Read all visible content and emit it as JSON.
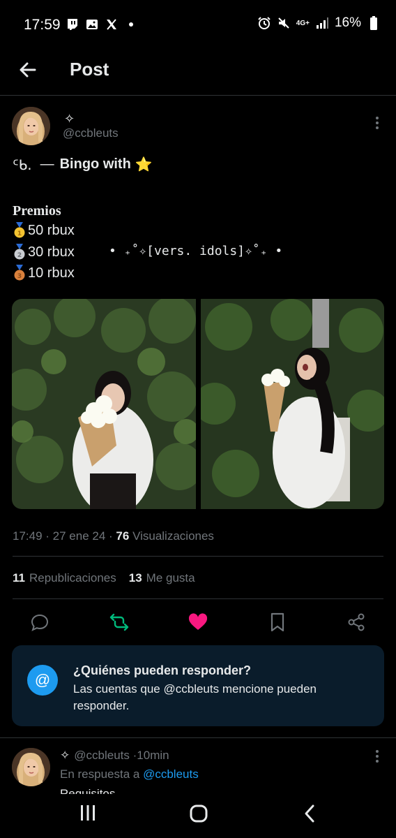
{
  "status": {
    "time": "17:59",
    "network": "4G+",
    "battery": "16%"
  },
  "header": {
    "title": "Post"
  },
  "post": {
    "display_name": "✧",
    "handle": "@ccbleuts",
    "line1_prefix": "ᑦᑲ.",
    "line1_dash": "—",
    "line1_text": "Bingo with",
    "line1_emoji": "⭐",
    "premios_label": "Premios",
    "prizes": [
      {
        "medal": "gold",
        "text": "50 rbux"
      },
      {
        "medal": "silver",
        "text": "30 rbux"
      },
      {
        "medal": "bronze",
        "text": "10 rbux"
      }
    ],
    "vers_text": "• ₊˚✧[vers. idols]✧˚₊ •",
    "time": "17:49",
    "date": "27 ene 24",
    "views_count": "76",
    "views_label": "Visualizaciones",
    "reposts_count": "11",
    "reposts_label": "Republicaciones",
    "likes_count": "13",
    "likes_label": "Me gusta"
  },
  "colors": {
    "accent": "#1d9bf0",
    "retweet": "#00ba7c",
    "like": "#f91880",
    "muted": "#71767b"
  },
  "reply_card": {
    "title": "¿Quiénes pueden responder?",
    "body": "Las cuentas que @ccbleuts mencione pueden responder."
  },
  "reply": {
    "display_name": "✧",
    "handle": "@ccbleuts",
    "separator": "·",
    "time": "10min",
    "replying_prefix": "En respuesta a",
    "replying_to": "@ccbleuts",
    "cut_text": "Requisitos"
  },
  "icons": [
    "back-arrow-icon",
    "kebab-icon",
    "reply-icon",
    "retweet-icon",
    "like-icon",
    "bookmark-icon",
    "share-icon",
    "at-icon",
    "recents-icon",
    "home-icon",
    "nav-back-icon"
  ]
}
